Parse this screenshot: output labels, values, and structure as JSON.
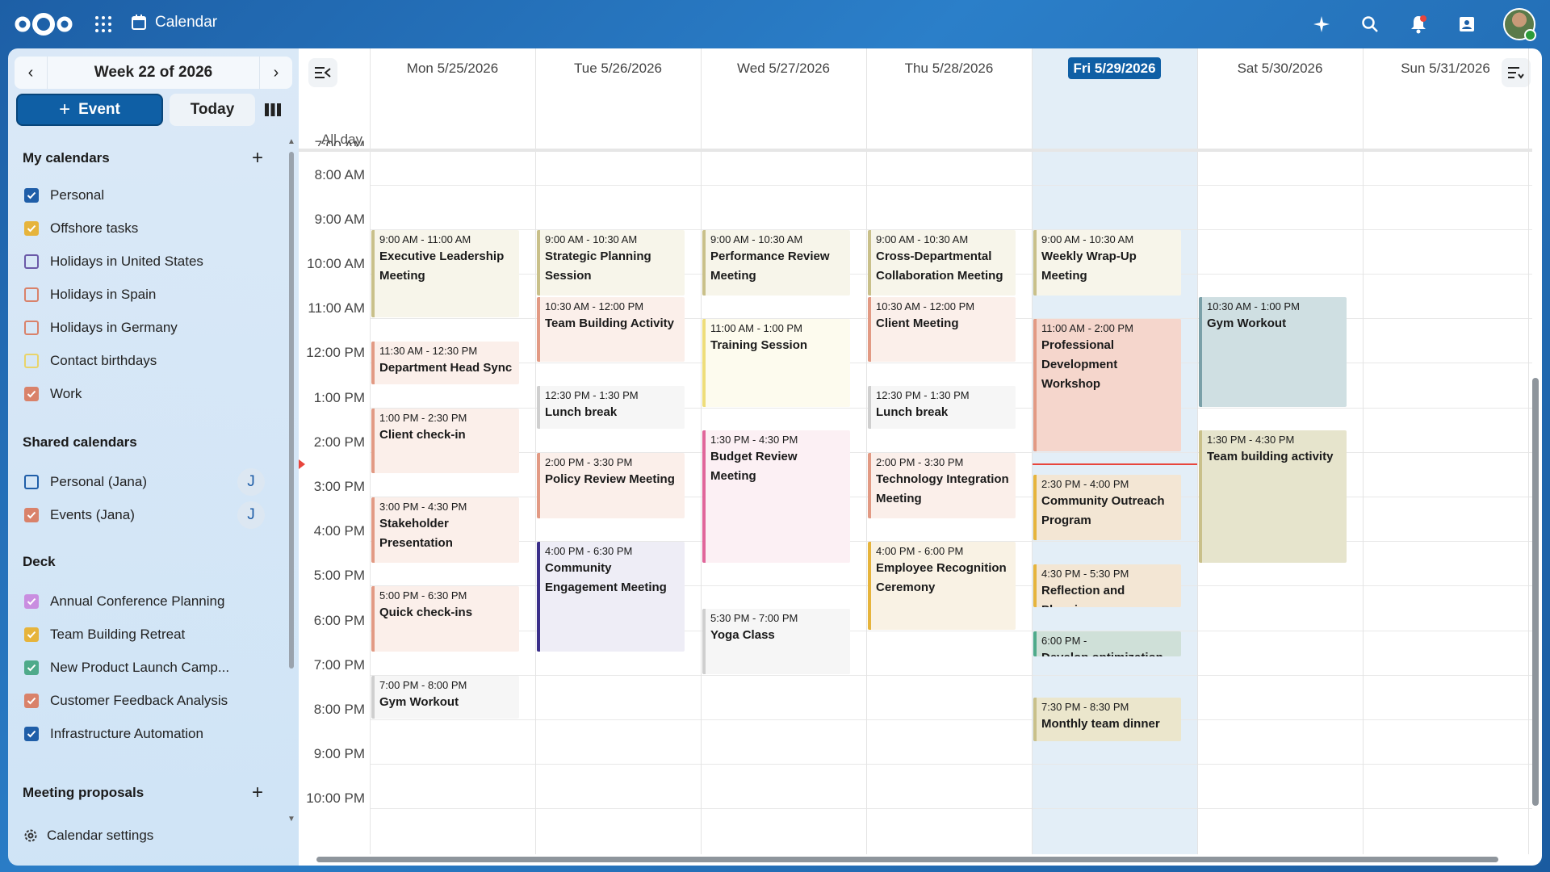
{
  "header": {
    "app_title": "Calendar"
  },
  "sidebar": {
    "week_label": "Week 22 of 2026",
    "event_btn": "Event",
    "today_btn": "Today",
    "my_calendars": {
      "title": "My calendars",
      "items": [
        {
          "label": "Personal",
          "color": "#1f5ea8",
          "checked": true
        },
        {
          "label": "Offshore tasks",
          "color": "#e6b43c",
          "checked": true
        },
        {
          "label": "Holidays in United States",
          "color": "#6b5aa8",
          "checked": false
        },
        {
          "label": "Holidays in Spain",
          "color": "#d9826a",
          "checked": false
        },
        {
          "label": "Holidays in Germany",
          "color": "#d9826a",
          "checked": false
        },
        {
          "label": "Contact birthdays",
          "color": "#e9d46a",
          "checked": false
        },
        {
          "label": "Work",
          "color": "#d9826a",
          "checked": true
        }
      ]
    },
    "shared_calendars": {
      "title": "Shared calendars",
      "items": [
        {
          "label": "Personal (Jana)",
          "color": "#1f5ea8",
          "checked": false,
          "badge": "J"
        },
        {
          "label": "Events (Jana)",
          "color": "#d9826a",
          "checked": true,
          "badge": "J"
        }
      ]
    },
    "deck": {
      "title": "Deck",
      "items": [
        {
          "label": "Annual Conference Planning",
          "color": "#c98ee0",
          "checked": true
        },
        {
          "label": "Team Building Retreat",
          "color": "#e6b43c",
          "checked": true
        },
        {
          "label": "New Product Launch Camp...",
          "color": "#4faa8a",
          "checked": true
        },
        {
          "label": "Customer Feedback Analysis",
          "color": "#d9826a",
          "checked": true
        },
        {
          "label": "Infrastructure Automation",
          "color": "#1f5ea8",
          "checked": true
        }
      ]
    },
    "meeting_proposals": {
      "title": "Meeting proposals"
    },
    "settings_label": "Calendar settings"
  },
  "main": {
    "allday_label": "All day",
    "days": [
      "Mon 5/25/2026",
      "Tue 5/26/2026",
      "Wed 5/27/2026",
      "Thu 5/28/2026",
      "Fri 5/29/2026",
      "Sat 5/30/2026",
      "Sun 5/31/2026"
    ],
    "today_index": 4,
    "partial_time_label": "7:00 AM",
    "times": [
      "8:00 AM",
      "9:00 AM",
      "10:00 AM",
      "11:00 AM",
      "12:00 PM",
      "1:00 PM",
      "2:00 PM",
      "3:00 PM",
      "4:00 PM",
      "5:00 PM",
      "6:00 PM",
      "7:00 PM",
      "8:00 PM",
      "9:00 PM",
      "10:00 PM"
    ],
    "now_hour": 14.25,
    "events": [
      {
        "day": 0,
        "start": 9,
        "end": 11,
        "time": "9:00 AM - 11:00 AM",
        "title": "Executive Leadership Meeting",
        "accent": "#c9c08a",
        "bg": "#f7f5ea"
      },
      {
        "day": 0,
        "start": 11.5,
        "end": 12.5,
        "time": "11:30 AM - 12:30 PM",
        "title": "Department Head Sync",
        "accent": "#e29a84",
        "bg": "#fbefea"
      },
      {
        "day": 0,
        "start": 13,
        "end": 14.5,
        "time": "1:00 PM - 2:30 PM",
        "title": "Client check-in",
        "accent": "#e29a84",
        "bg": "#fbefea"
      },
      {
        "day": 0,
        "start": 15,
        "end": 16.5,
        "time": "3:00 PM - 4:30 PM",
        "title": "Stakeholder Presentation",
        "accent": "#e29a84",
        "bg": "#fbefea"
      },
      {
        "day": 0,
        "start": 17,
        "end": 18.5,
        "time": "5:00 PM - 6:30 PM",
        "title": "Quick check-ins",
        "accent": "#e29a84",
        "bg": "#fbefea"
      },
      {
        "day": 0,
        "start": 19,
        "end": 20,
        "time": "7:00 PM - 8:00 PM",
        "title": "Gym Workout",
        "accent": "#cfcfcf",
        "bg": "#f6f6f6"
      },
      {
        "day": 1,
        "start": 9,
        "end": 10.5,
        "time": "9:00 AM - 10:30 AM",
        "title": "Strategic Planning Session",
        "accent": "#c9c08a",
        "bg": "#f7f5ea"
      },
      {
        "day": 1,
        "start": 10.5,
        "end": 12,
        "time": "10:30 AM - 12:00 PM",
        "title": "Team Building Activity",
        "accent": "#e29a84",
        "bg": "#fbefea"
      },
      {
        "day": 1,
        "start": 12.5,
        "end": 13.5,
        "time": "12:30 PM - 1:30 PM",
        "title": "Lunch break",
        "accent": "#cfcfcf",
        "bg": "#f6f6f6"
      },
      {
        "day": 1,
        "start": 14,
        "end": 15.5,
        "time": "2:00 PM - 3:30 PM",
        "title": "Policy Review Meeting",
        "accent": "#e29a84",
        "bg": "#fbefea"
      },
      {
        "day": 1,
        "start": 16,
        "end": 18.5,
        "time": "4:00 PM - 6:30 PM",
        "title": "Community Engagement Meeting",
        "accent": "#3b2f8a",
        "bg": "#eeedf6"
      },
      {
        "day": 2,
        "start": 9,
        "end": 10.5,
        "time": "9:00 AM - 10:30 AM",
        "title": "Performance Review Meeting",
        "accent": "#c9c08a",
        "bg": "#f7f5ea"
      },
      {
        "day": 2,
        "start": 11,
        "end": 13,
        "time": "11:00 AM - 1:00 PM",
        "title": "Training Session",
        "accent": "#eedd7a",
        "bg": "#fdfbee"
      },
      {
        "day": 2,
        "start": 13.5,
        "end": 16.5,
        "time": "1:30 PM - 4:30 PM",
        "title": "Budget Review Meeting",
        "accent": "#e0669a",
        "bg": "#fcf0f4"
      },
      {
        "day": 2,
        "start": 17.5,
        "end": 19,
        "time": "5:30 PM - 7:00 PM",
        "title": "Yoga Class",
        "accent": "#cfcfcf",
        "bg": "#f6f6f6"
      },
      {
        "day": 3,
        "start": 9,
        "end": 10.5,
        "time": "9:00 AM - 10:30 AM",
        "title": "Cross-Departmental Collaboration Meeting",
        "accent": "#c9c08a",
        "bg": "#f7f5ea"
      },
      {
        "day": 3,
        "start": 10.5,
        "end": 12,
        "time": "10:30 AM - 12:00 PM",
        "title": "Client Meeting",
        "accent": "#e29a84",
        "bg": "#fbefea"
      },
      {
        "day": 3,
        "start": 12.5,
        "end": 13.5,
        "time": "12:30 PM - 1:30 PM",
        "title": "Lunch break",
        "accent": "#cfcfcf",
        "bg": "#f6f6f6"
      },
      {
        "day": 3,
        "start": 14,
        "end": 15.5,
        "time": "2:00 PM - 3:30 PM",
        "title": "Technology Integration Meeting",
        "accent": "#e29a84",
        "bg": "#fbefea"
      },
      {
        "day": 3,
        "start": 16,
        "end": 18,
        "time": "4:00 PM - 6:00 PM",
        "title": "Employee Recognition Ceremony",
        "accent": "#e6b43c",
        "bg": "#f9f2e4"
      },
      {
        "day": 4,
        "start": 9,
        "end": 10.5,
        "time": "9:00 AM - 10:30 AM",
        "title": "Weekly Wrap-Up Meeting",
        "accent": "#c9c08a",
        "bg": "#f7f5ea"
      },
      {
        "day": 4,
        "start": 11,
        "end": 14,
        "time": "11:00 AM - 2:00 PM",
        "title": "Professional Development Workshop",
        "accent": "#e29a84",
        "bg": "#f5d6cc"
      },
      {
        "day": 4,
        "start": 14.5,
        "end": 16,
        "time": "2:30 PM - 4:00 PM",
        "title": "Community Outreach Program",
        "accent": "#e6b43c",
        "bg": "#f3e6d4"
      },
      {
        "day": 4,
        "start": 16.5,
        "end": 17.5,
        "time": "4:30 PM - 5:30 PM",
        "title": "Reflection and Planning",
        "accent": "#e6b43c",
        "bg": "#f3e6d4"
      },
      {
        "day": 4,
        "start": 18,
        "end": 18.6,
        "time": "6:00 PM -",
        "title": "Develop optimization",
        "accent": "#4faa8a",
        "bg": "#cfe0d8"
      },
      {
        "day": 4,
        "start": 19.5,
        "end": 20.5,
        "time": "7:30 PM - 8:30 PM",
        "title": "Monthly team dinner",
        "accent": "#c9c08a",
        "bg": "#ebe6cc"
      },
      {
        "day": 5,
        "start": 10.5,
        "end": 13,
        "time": "10:30 AM - 1:00 PM",
        "title": "Gym Workout",
        "accent": "#7aa0a8",
        "bg": "#cfdfe2"
      },
      {
        "day": 5,
        "start": 13.5,
        "end": 16.5,
        "time": "1:30 PM - 4:30 PM",
        "title": "Team building activity",
        "accent": "#c9c08a",
        "bg": "#e6e4cc"
      }
    ]
  }
}
